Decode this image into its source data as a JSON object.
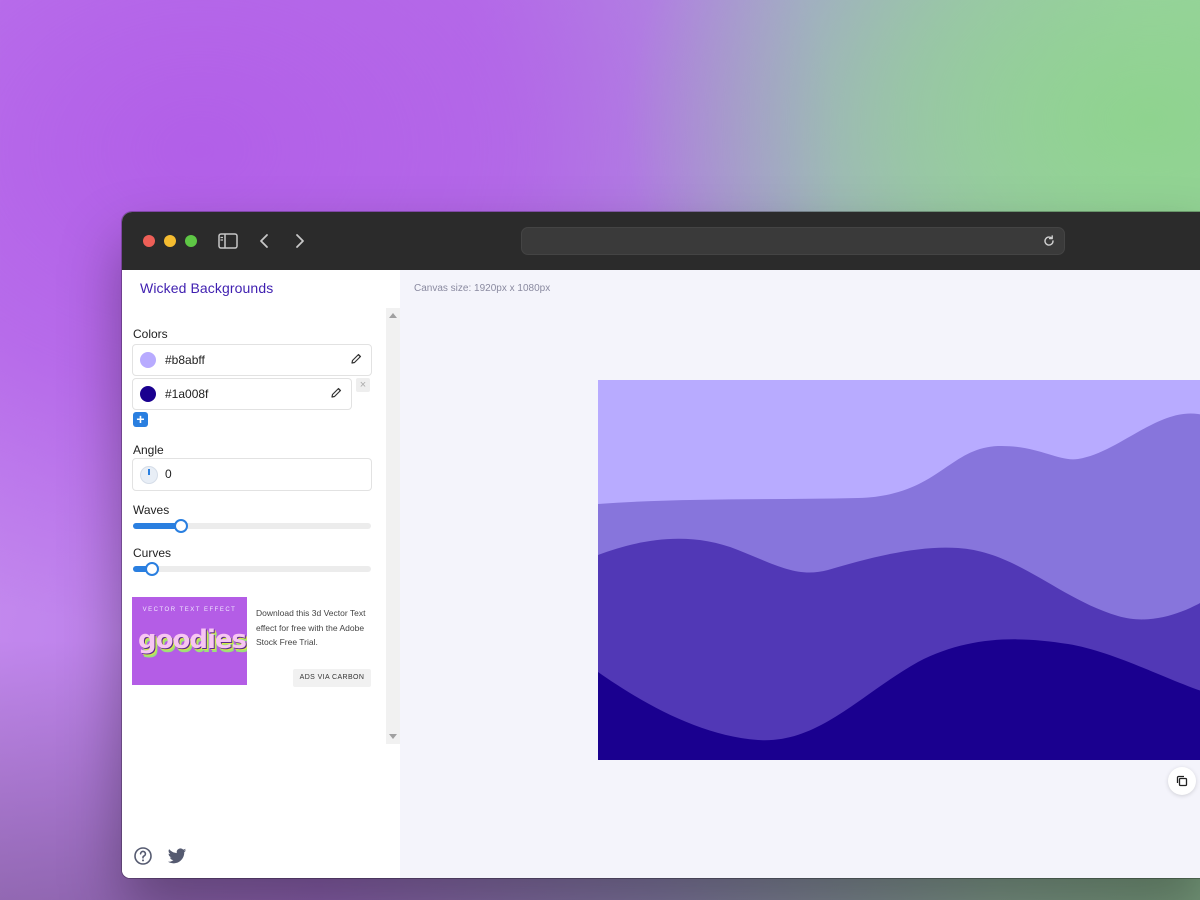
{
  "app": {
    "brand": "Wicked Backgrounds",
    "canvas_size": "Canvas size: 1920px x 1080px"
  },
  "controls": {
    "colors_label": "Colors",
    "colors": [
      {
        "hex": "#b8abff"
      },
      {
        "hex": "#1a008f"
      }
    ],
    "add_label": "+",
    "remove_label": "×",
    "angle_label": "Angle",
    "angle_value": "0",
    "waves_label": "Waves",
    "waves_level": 0.2,
    "curves_label": "Curves",
    "curves_level": 0.08
  },
  "ad": {
    "image_top_text": "VECTOR TEXT EFFECT",
    "image_word": "goodies",
    "text": "Download this 3d Vector Text effect for free with the Adobe Stock Free Trial.",
    "button": "ADS VIA CARBON"
  },
  "wave_colors": [
    "#b8abff",
    "#8775dc",
    "#5138b6",
    "#1a008f"
  ],
  "icons": {
    "window": [
      "close-dot",
      "minimize-dot",
      "zoom-dot",
      "sidebar-toggle-icon",
      "chevron-left-icon",
      "chevron-right-icon",
      "reload-icon"
    ],
    "panel": [
      "eyedropper-icon",
      "help-icon",
      "twitter-icon",
      "copy-icon"
    ]
  }
}
